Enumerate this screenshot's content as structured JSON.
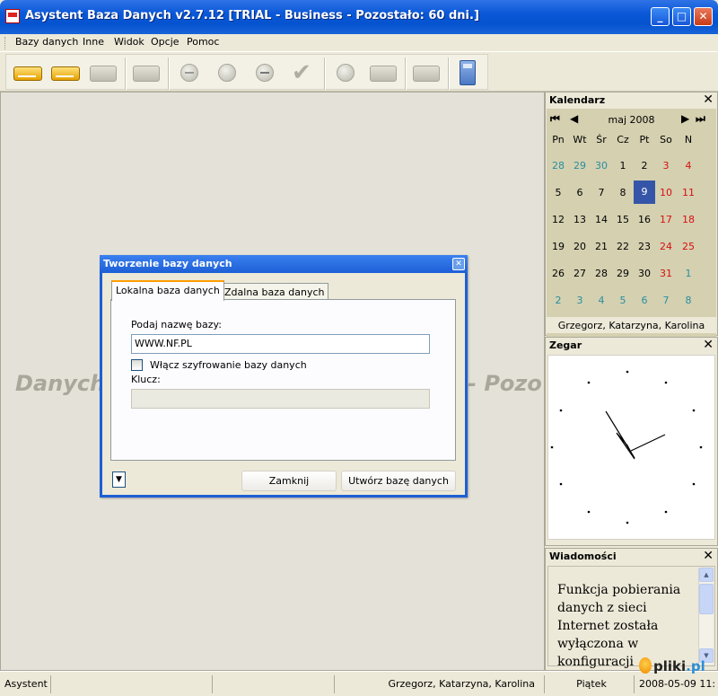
{
  "window": {
    "title": "Asystent Baza Danych v2.7.12  [TRIAL - Business - Pozostało: 60 dni.]",
    "minimize": "_",
    "maximize": "□",
    "close": "✕"
  },
  "menu": [
    "Bazy danych",
    "Inne",
    "Widok",
    "Opcje",
    "Pomoc"
  ],
  "toolbar": {
    "buttons": [
      {
        "icon": "database-open-icon",
        "enabled": true
      },
      {
        "icon": "database-icon",
        "enabled": true
      },
      {
        "icon": "database-delete-icon",
        "enabled": false
      },
      {
        "icon": "printer-icon",
        "enabled": false
      },
      {
        "icon": "add-icon",
        "enabled": false
      },
      {
        "icon": "record-icon",
        "enabled": false
      },
      {
        "icon": "remove-icon",
        "enabled": false
      },
      {
        "icon": "check-icon",
        "enabled": false
      },
      {
        "icon": "refresh-icon",
        "enabled": false
      },
      {
        "icon": "form-icon",
        "enabled": false
      },
      {
        "icon": "export-icon",
        "enabled": false
      },
      {
        "icon": "calculator-icon",
        "enabled": true
      }
    ]
  },
  "main": {
    "watermark_left": "Danych",
    "watermark_right": "- Pozo"
  },
  "dialog": {
    "title": "Tworzenie bazy danych",
    "close": "✕",
    "tabs": [
      "Lokalna baza danych",
      "Zdalna baza danych"
    ],
    "active_tab": "Lokalna baza danych",
    "name_label": "Podaj nazwę bazy:",
    "name_value": "WWW.NF.PL",
    "encrypt_label": "Włącz szyfrowanie bazy danych",
    "encrypt_checked": false,
    "key_label": "Klucz:",
    "key_value": "",
    "dropdown_arrow": "▼",
    "close_button": "Zamknij",
    "create_button": "Utwórz bazę danych"
  },
  "calendar": {
    "title": "Kalendarz",
    "close": "✕",
    "month": "maj 2008",
    "nav": {
      "first": "⏮",
      "prev": "◀",
      "next": "▶",
      "last": "⏭"
    },
    "day_names": [
      "Pn",
      "Wt",
      "Śr",
      "Cz",
      "Pt",
      "So",
      "N"
    ],
    "weeks": [
      [
        "28",
        "29",
        "30",
        "1",
        "2",
        "3",
        "4"
      ],
      [
        "5",
        "6",
        "7",
        "8",
        "9",
        "10",
        "11"
      ],
      [
        "12",
        "13",
        "14",
        "15",
        "16",
        "17",
        "18"
      ],
      [
        "19",
        "20",
        "21",
        "22",
        "23",
        "24",
        "25"
      ],
      [
        "26",
        "27",
        "28",
        "29",
        "30",
        "31",
        "1"
      ],
      [
        "2",
        "3",
        "4",
        "5",
        "6",
        "7",
        "8"
      ]
    ],
    "selected": "9",
    "footer": "Grzegorz, Katarzyna, Karolina",
    "colors": {
      "other_month": "#2a8ea0",
      "weekend": "#d81010",
      "selected_bg": "#3556a8"
    }
  },
  "clock": {
    "title": "Zegar",
    "close": "✕"
  },
  "messages": {
    "title": "Wiadomości",
    "close": "✕",
    "text": "Funkcja pobierania danych z sieci Internet została wyłączona w konfiguracji"
  },
  "status": {
    "app": "Asystent",
    "names": "Grzegorz, Katarzyna, Karolina",
    "weekday": "Piątek",
    "datetime": "2008-05-09 11:"
  },
  "logo": {
    "text": "pliki",
    "suffix": ".pl"
  }
}
